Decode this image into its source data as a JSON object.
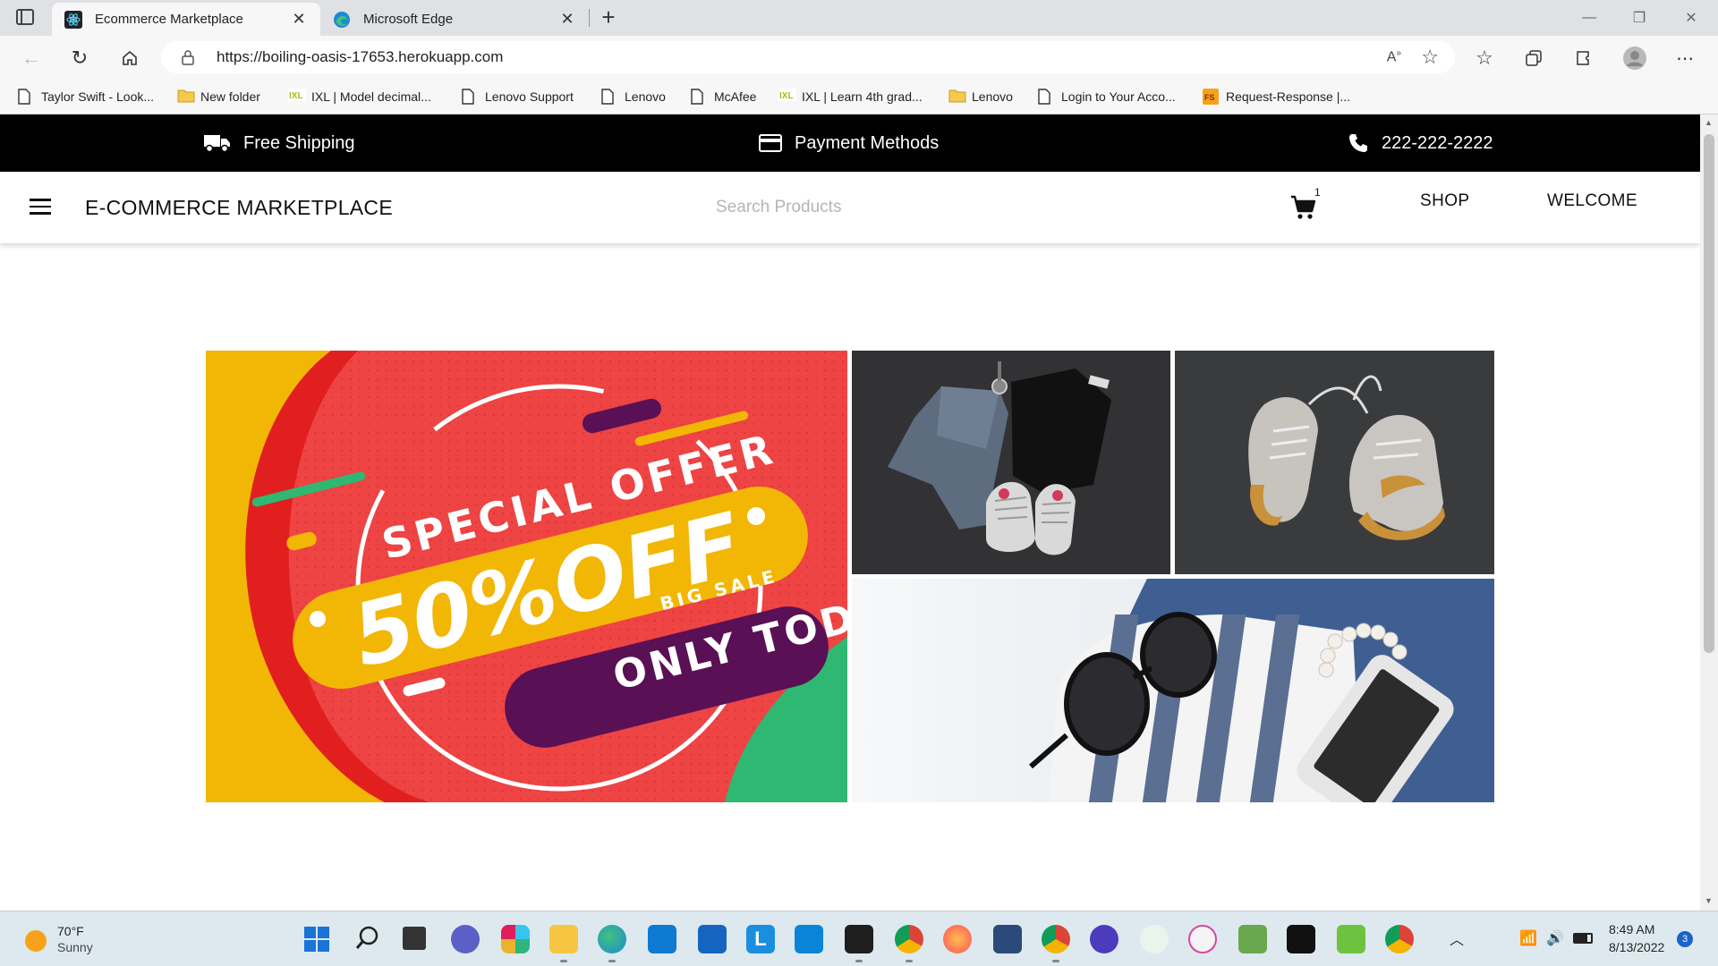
{
  "browser": {
    "tabs": [
      {
        "title": "Ecommerce Marketplace",
        "active": true,
        "icon": "react-icon"
      },
      {
        "title": "Microsoft Edge",
        "active": false,
        "icon": "edge-icon"
      }
    ],
    "url": "https://boiling-oasis-17653.herokuapp.com",
    "bookmarks": [
      {
        "label": "Taylor Swift - Look...",
        "icon": "page-icon"
      },
      {
        "label": "New folder",
        "icon": "folder-icon"
      },
      {
        "label": "IXL | Model decimal...",
        "icon": "ixl-icon"
      },
      {
        "label": "Lenovo Support",
        "icon": "page-icon"
      },
      {
        "label": "Lenovo",
        "icon": "page-icon"
      },
      {
        "label": "McAfee",
        "icon": "page-icon"
      },
      {
        "label": "IXL | Learn 4th grad...",
        "icon": "ixl-icon"
      },
      {
        "label": "Lenovo",
        "icon": "folder-icon"
      },
      {
        "label": "Login to Your Acco...",
        "icon": "page-icon"
      },
      {
        "label": "Request-Response |...",
        "icon": "fs-icon"
      }
    ]
  },
  "site": {
    "topbar": {
      "shipping": "Free Shipping",
      "payment": "Payment Methods",
      "phone": "222-222-2222"
    },
    "header": {
      "brand": "E-COMMERCE MARKETPLACE",
      "search_placeholder": "Search Products",
      "cart_count": "1",
      "nav": [
        "SHOP",
        "WELCOME"
      ]
    },
    "banner": {
      "headline": "SPECIAL OFFER",
      "discount": "50%OFF",
      "tag": "BIG SALE",
      "footer": "ONLY TODAY",
      "colors": {
        "red": "#ee4444",
        "yellow": "#f2b705",
        "purple": "#5a1055",
        "green": "#2eb872"
      }
    }
  },
  "taskbar": {
    "weather_temp": "70°F",
    "weather_desc": "Sunny",
    "time": "8:49 AM",
    "date": "8/13/2022",
    "notifications": "3"
  }
}
